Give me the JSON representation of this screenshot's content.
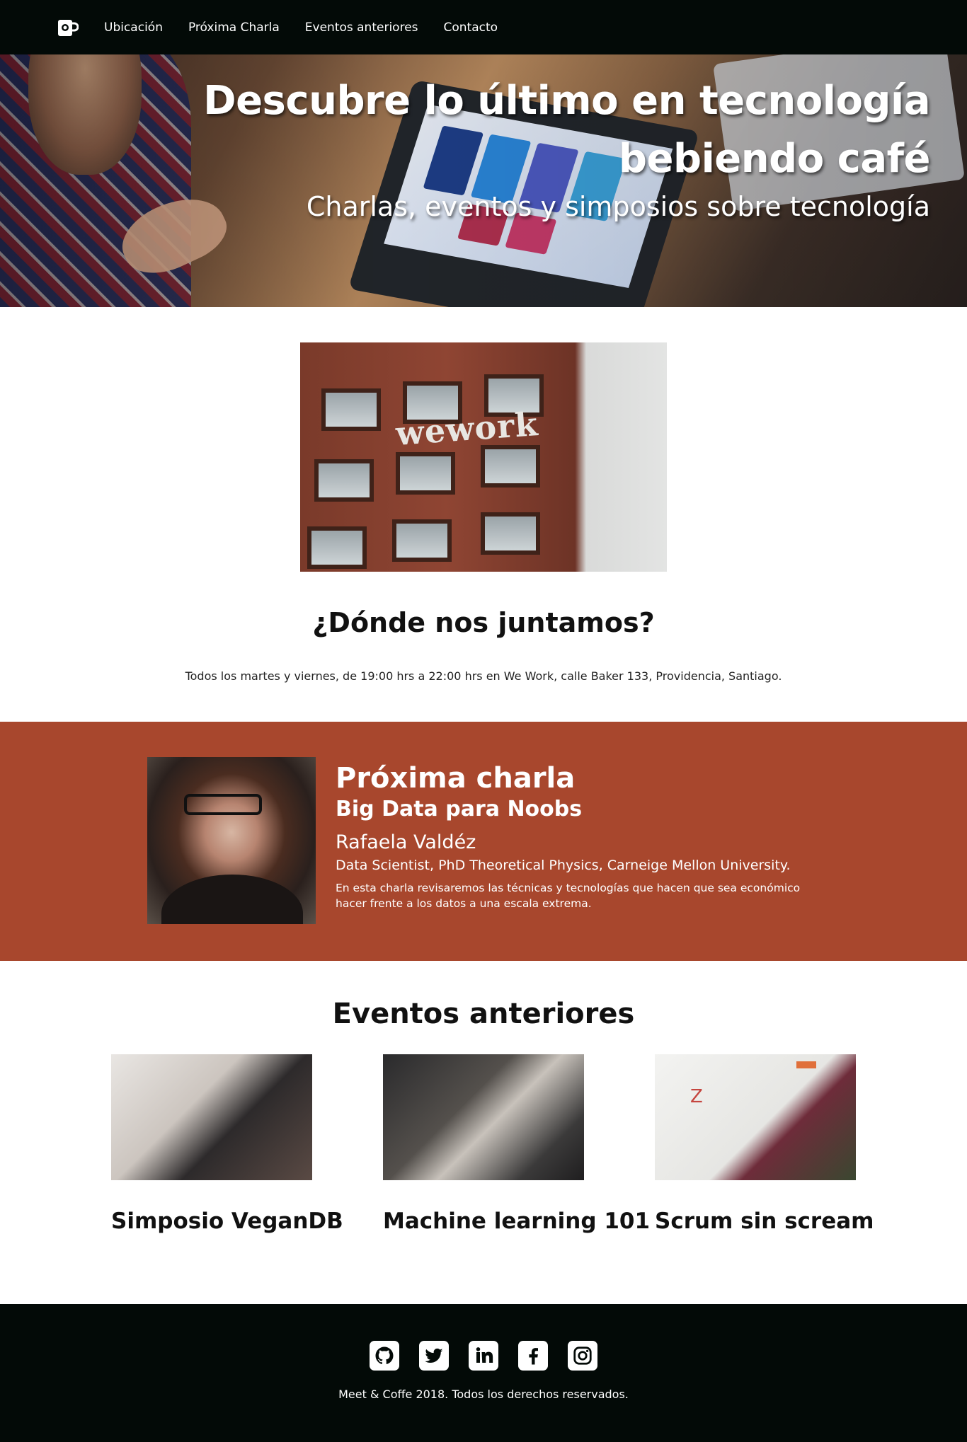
{
  "nav": {
    "logo_icon": "coffee-mug-icon",
    "items": [
      "Ubicación",
      "Próxima Charla",
      "Eventos anteriores",
      "Contacto"
    ]
  },
  "hero": {
    "title": "Descubre lo último en tecnología bebiendo café",
    "subtitle": "Charlas, eventos y simposios sobre tecnología"
  },
  "location": {
    "image_text": "wework",
    "title": "¿Dónde nos juntamos?",
    "text": "Todos los martes y viernes, de 19:00 hrs a 22:00 hrs en We Work, calle Baker 133, Providencia, Santiago."
  },
  "next_talk": {
    "heading": "Próxima charla",
    "title": "Big Data para Noobs",
    "speaker": "Rafaela Valdéz",
    "role": "Data Scientist, PhD Theoretical Physics, Carneige Mellon University.",
    "description": "En esta charla revisaremos las técnicas y tecnologías que hacen que sea económico hacer frente a los datos a una escala extrema."
  },
  "past_events": {
    "heading": "Eventos anteriores",
    "items": [
      {
        "title": "Simposio VeganDB"
      },
      {
        "title": "Machine learning 101"
      },
      {
        "title": "Scrum sin scream"
      }
    ]
  },
  "footer": {
    "social_icons": [
      "github-icon",
      "twitter-icon",
      "linkedin-icon",
      "facebook-icon",
      "instagram-icon"
    ],
    "copyright": "Meet & Coffe 2018. Todos los derechos reservados."
  },
  "colors": {
    "nav_bg": "#030a07",
    "accent": "#a8472d",
    "text": "#111111"
  }
}
